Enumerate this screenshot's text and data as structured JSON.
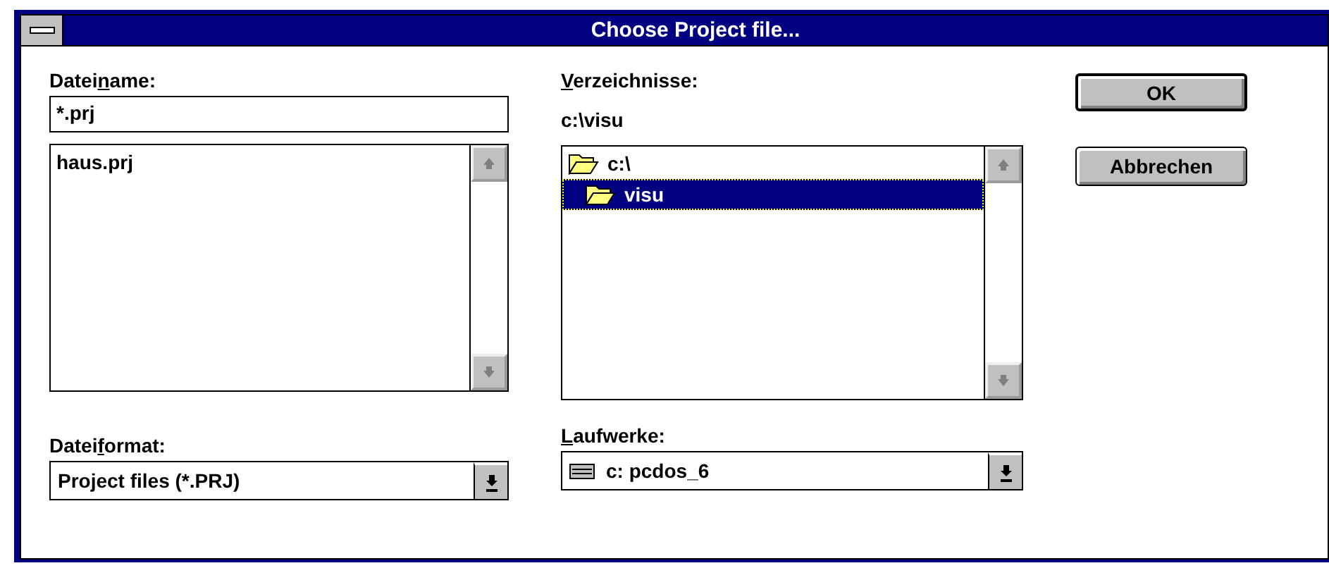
{
  "window": {
    "title": "Choose Project file..."
  },
  "file_name": {
    "label": {
      "before": "Datei",
      "mnemonic": "n",
      "after": "ame:"
    },
    "value": "*.prj",
    "files": [
      {
        "name": "haus.prj",
        "selected": false
      }
    ]
  },
  "directories": {
    "label": {
      "mnemonic": "V",
      "after": "erzeichnisse:"
    },
    "current": "c:\\visu",
    "items": [
      {
        "name": "c:\\",
        "selected": false,
        "children": [
          {
            "name": "visu",
            "selected": true
          }
        ]
      }
    ]
  },
  "file_format": {
    "label": {
      "before": "Datei",
      "mnemonic": "f",
      "after": "ormat:"
    },
    "value": "Project files (*.PRJ)"
  },
  "drives": {
    "label": {
      "mnemonic": "L",
      "after": "aufwerke:"
    },
    "value": "c: pcdos_6"
  },
  "buttons": [
    {
      "label": "OK",
      "default": true
    },
    {
      "label": "Abbrechen",
      "default": false
    }
  ]
}
